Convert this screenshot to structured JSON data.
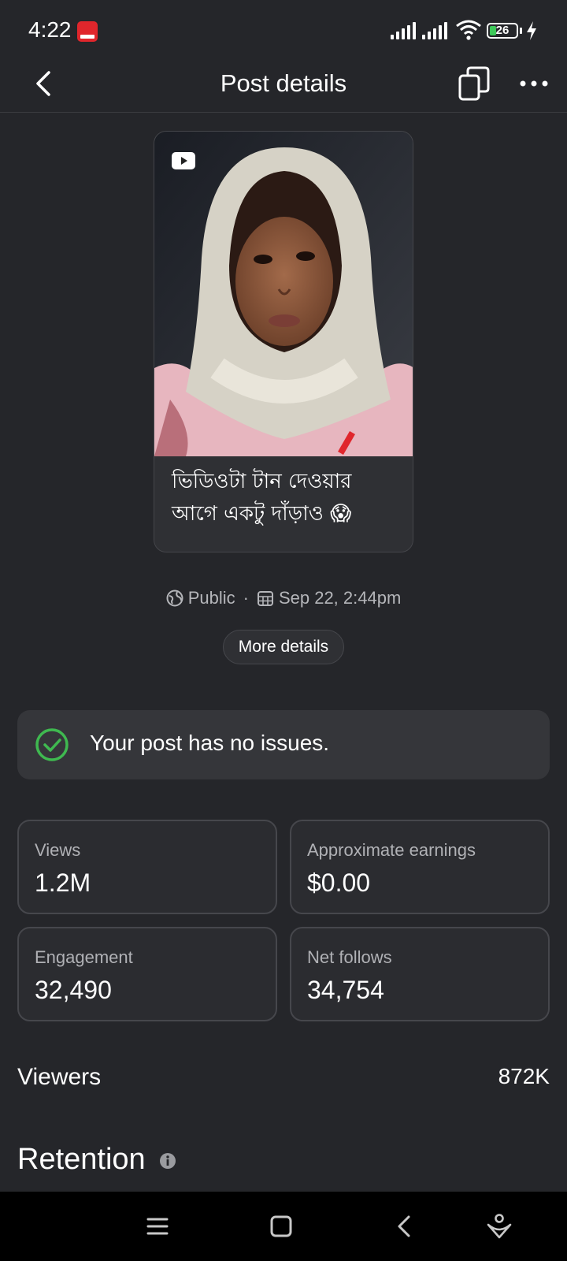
{
  "status_bar": {
    "time": "4:22",
    "battery": "26",
    "battery_level": 0.26,
    "icons": [
      "app-notification-icon",
      "cellular-signal-icon",
      "cellular-signal-icon",
      "wifi-icon",
      "battery-icon",
      "charging-bolt-icon"
    ]
  },
  "header": {
    "title": "Post details",
    "back_icon": "chevron-left-icon",
    "copy_icon": "copy-icon",
    "more_icon": "more-horizontal-icon"
  },
  "post": {
    "caption": "ভিডিওটা টান দেওয়ার আগে একটু দাঁড়াও 😱",
    "video_icon": "youtube-play-icon"
  },
  "meta": {
    "visibility": "Public",
    "separator": "·",
    "date": "Sep 22, 2:44pm",
    "globe_icon": "globe-icon",
    "calendar_icon": "calendar-icon"
  },
  "more_details_label": "More details",
  "issues": {
    "text": "Your post has no issues.",
    "icon": "check-circle-icon",
    "color": "#3fb950"
  },
  "stats": [
    {
      "label": "Views",
      "value": "1.2M"
    },
    {
      "label": "Approximate earnings",
      "value": "$0.00"
    },
    {
      "label": "Engagement",
      "value": "32,490"
    },
    {
      "label": "Net follows",
      "value": "34,754"
    }
  ],
  "viewers": {
    "label": "Viewers",
    "value": "872K"
  },
  "retention": {
    "title": "Retention",
    "icon": "info-icon"
  },
  "nav_bar": {
    "icons": [
      "menu-icon",
      "home-square-icon",
      "back-icon",
      "assistant-icon"
    ]
  },
  "colors": {
    "background": "#25262a",
    "card": "#2f3034",
    "border": "#46474c",
    "accent_green": "#3fb950"
  }
}
